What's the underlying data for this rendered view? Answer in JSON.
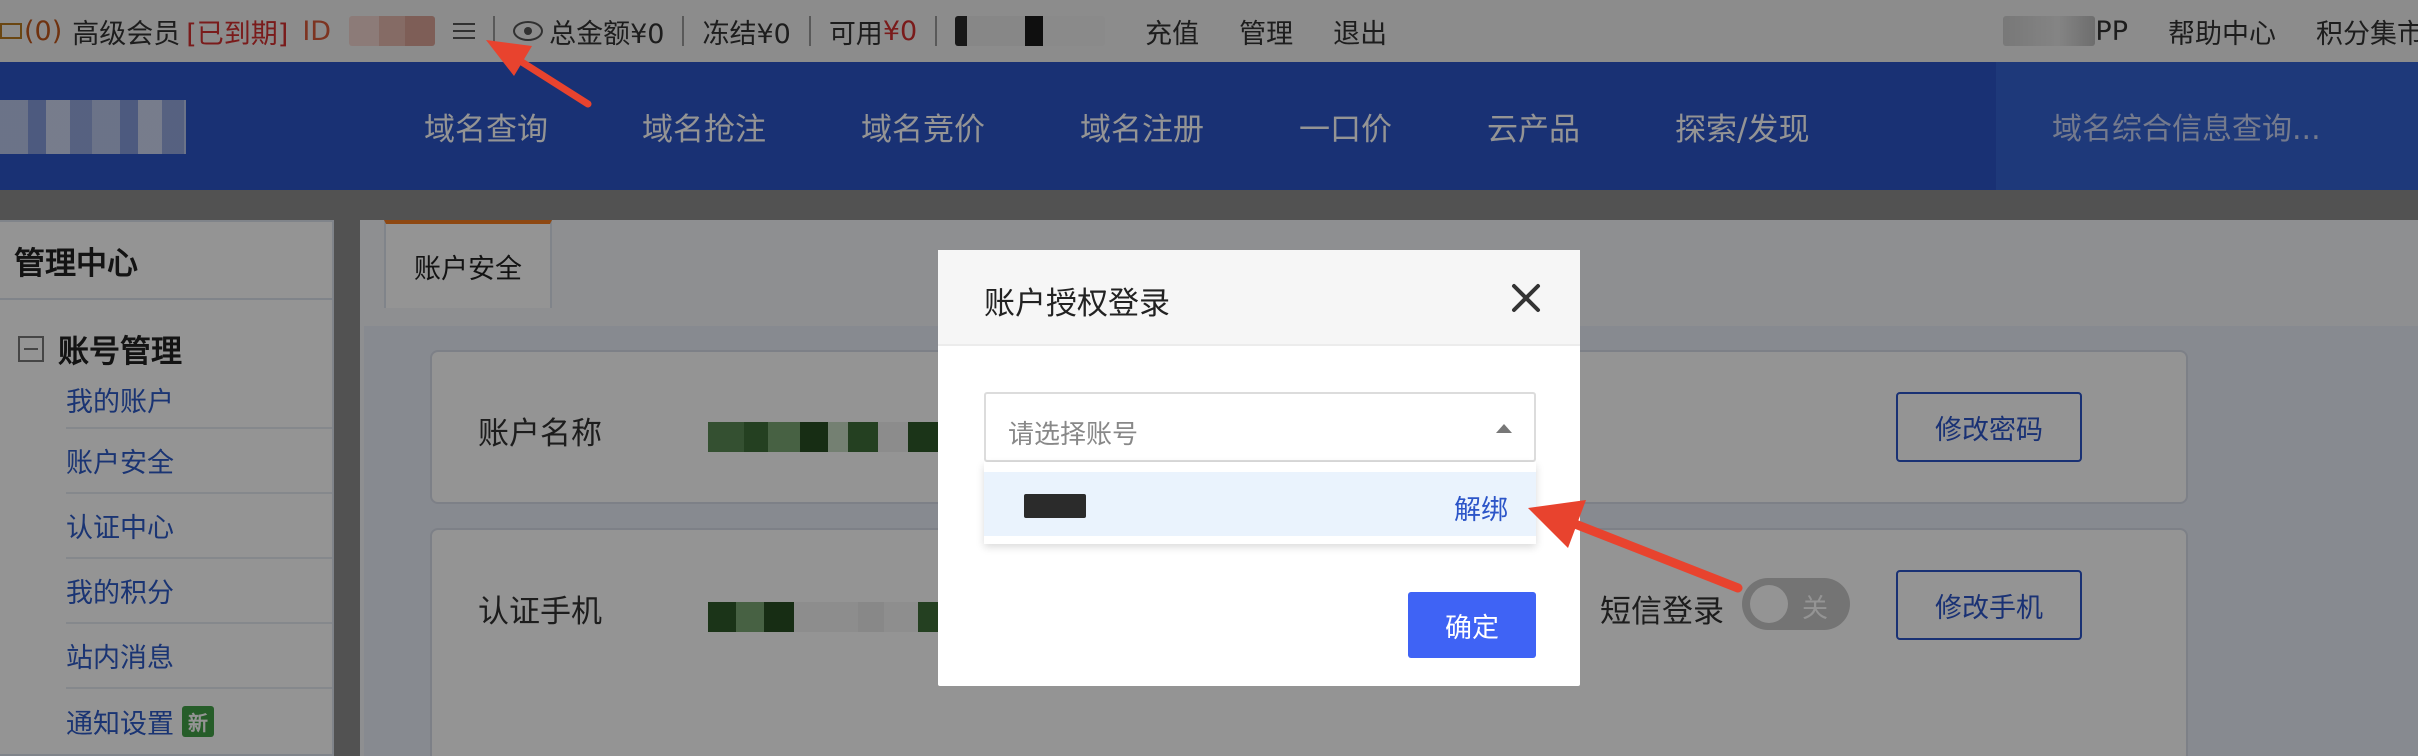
{
  "topbar": {
    "mail_count": "(0)",
    "member_level": "高级会员",
    "member_status": "[已到期]",
    "id_label": "ID",
    "total_amount": "总金额¥0",
    "frozen": "冻结¥0",
    "available_label": "可用",
    "available_value": "¥0",
    "recharge": "充值",
    "manage": "管理",
    "logout": "退出",
    "app": "PP",
    "help_center": "帮助中心",
    "points_market": "积分集市"
  },
  "nav": {
    "items": [
      "域名查询",
      "域名抢注",
      "域名竞价",
      "域名注册",
      "一口价",
      "云产品",
      "探索/发现"
    ],
    "search_placeholder": "域名综合信息查询..."
  },
  "sidebar": {
    "title": "管理中心",
    "group": "账号管理",
    "items": [
      "我的账户",
      "账户安全",
      "认证中心",
      "我的积分",
      "站内消息",
      "通知设置"
    ],
    "new_badge": "新"
  },
  "content": {
    "active_tab": "账户安全",
    "account_name_label": "账户名称",
    "change_password": "修改密码",
    "verified_phone_label": "认证手机",
    "sms_login_label": "短信登录",
    "sms_toggle_text": "关",
    "change_phone": "修改手机"
  },
  "modal": {
    "title": "账户授权登录",
    "select_placeholder": "请选择账号",
    "option_action": "解绑",
    "confirm": "确定"
  },
  "colors": {
    "brand_blue": "#2c55c8",
    "primary_button": "#3f63f5",
    "status_red": "#d32f2f",
    "annotation_arrow": "#e8432e"
  }
}
